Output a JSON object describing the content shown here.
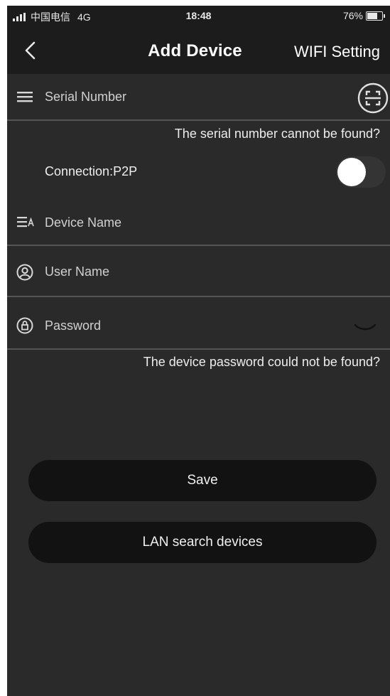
{
  "status_bar": {
    "carrier": "中国电信",
    "network": "4G",
    "time": "18:48",
    "battery": "76%",
    "battery_level": 0.76
  },
  "nav": {
    "back_icon": "chevron-left-icon",
    "title": "Add Device",
    "wifi_setting_label": "WIFI Setting"
  },
  "form": {
    "serial_number": {
      "placeholder": "Serial Number",
      "icon": "list-icon",
      "scan_icon": "scan-icon"
    },
    "serial_help": "The serial number cannot be found?",
    "connection": {
      "label": "Connection:P2P",
      "toggle_on": false
    },
    "device_name": {
      "placeholder": "Device Name",
      "icon": "device-name-icon"
    },
    "user_name": {
      "placeholder": "User Name",
      "icon": "user-icon"
    },
    "password": {
      "placeholder": "Password",
      "icon": "lock-icon",
      "toggle_icon": "eye-closed-icon"
    },
    "password_help": "The device password could not be found?"
  },
  "buttons": {
    "save_label": "Save",
    "lan_search_label": "LAN search devices"
  }
}
